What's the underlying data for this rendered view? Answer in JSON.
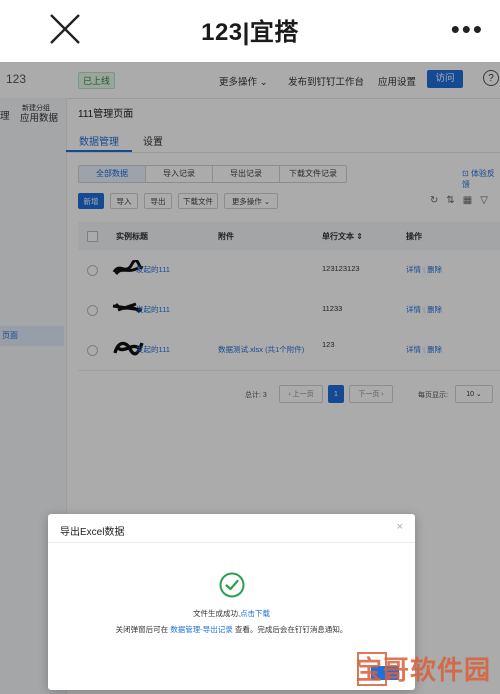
{
  "window": {
    "title": "123|宜搭"
  },
  "app": {
    "name": "123",
    "status": "已上线",
    "header_links": [
      "更多操作",
      "发布到钉钉工作台",
      "应用设置"
    ],
    "visit_label": "访问",
    "help_label": "?"
  },
  "sidebar": {
    "left_labels": [
      "理",
      "应用数据"
    ],
    "tiny_label": "新建分组",
    "active_item": "页面"
  },
  "page": {
    "title": "111管理页面",
    "tabs": [
      "数据管理",
      "设置"
    ],
    "segments": [
      "全部数据",
      "导入记录",
      "导出记录",
      "下载文件记录"
    ],
    "feedback": "体验反馈",
    "buttons": [
      "新增",
      "导入",
      "导出",
      "下载文件",
      "更多操作"
    ]
  },
  "table": {
    "headers": [
      "实例标题",
      "附件",
      "单行文本",
      "操作"
    ],
    "rows": [
      {
        "title": "发起的111",
        "attachment": "",
        "text": "123123123"
      },
      {
        "title": "发起的111",
        "attachment": "",
        "text": "11233"
      },
      {
        "title": "发起的111",
        "attachment": "数据测试.xlsx (共1个附件)",
        "text": "123"
      }
    ],
    "op_detail": "详情",
    "op_delete": "删除"
  },
  "pagination": {
    "total": "总计: 3",
    "prev": "上一页",
    "next": "下一页",
    "current": "1",
    "per_page_label": "每页显示:",
    "per_page": "10"
  },
  "dialog": {
    "title": "导出Excel数据",
    "msg_main": "文件生成成功,",
    "msg_link": "点击下载",
    "msg2_prefix": "关闭弹窗后可在",
    "msg2_link": "数据管理-导出记录",
    "msg2_suffix": "查看。完成后会在钉钉消息通知。"
  },
  "watermark": {
    "text": "宝哥软件园"
  },
  "colors": {
    "accent": "#1f6fdc",
    "success": "#2e9e4e",
    "watermark": "#d9603b"
  }
}
